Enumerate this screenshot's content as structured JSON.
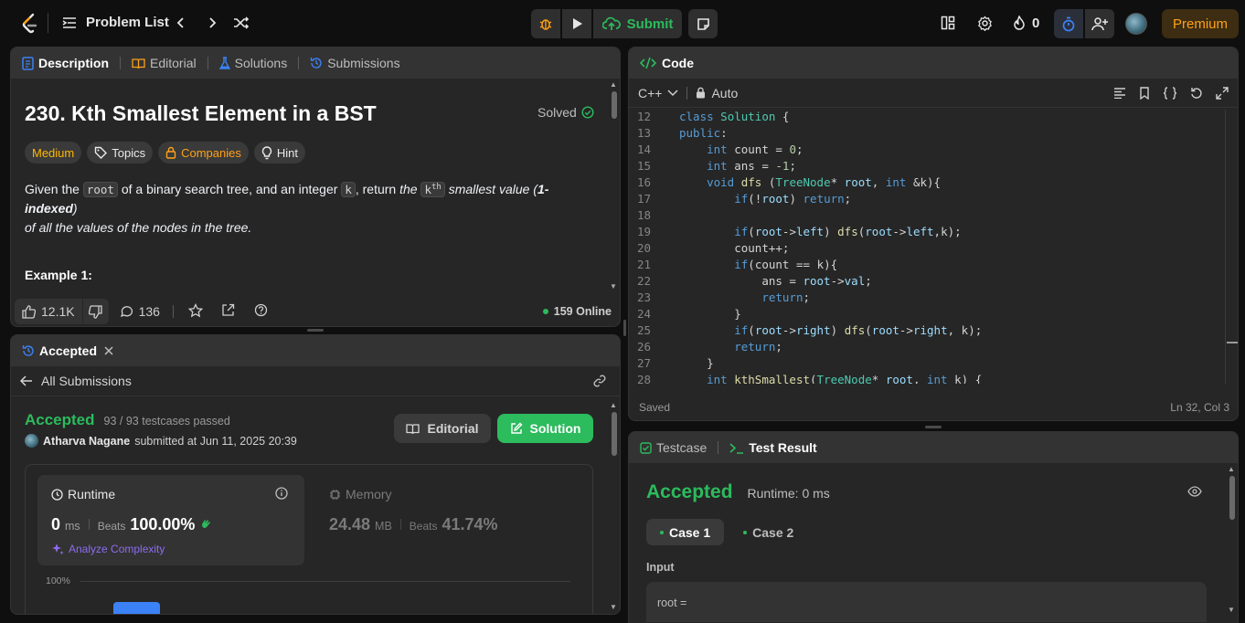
{
  "topbar": {
    "problem_list": "Problem List",
    "submit": "Submit",
    "streak_count": "0",
    "premium": "Premium"
  },
  "description": {
    "tabs": [
      "Description",
      "Editorial",
      "Solutions",
      "Submissions"
    ],
    "title": "230. Kth Smallest Element in a BST",
    "status": "Solved",
    "difficulty": "Medium",
    "chips": [
      "Topics",
      "Companies",
      "Hint"
    ],
    "text_1": "Given the",
    "code_root": "root",
    "text_2": "of a binary search tree, and an integer",
    "code_k": "k",
    "text_3": ", return",
    "text_the": "the",
    "code_kth_base": "k",
    "code_kth_sup": "th",
    "text_4": "smallest value (",
    "text_bold": "1-indexed",
    "text_5": ")",
    "text_6": "of all the values of the nodes in the tree.",
    "example_heading": "Example 1:",
    "likes": "12.1K",
    "comments": "136",
    "online": "159 Online"
  },
  "accepted_panel": {
    "tab": "Accepted",
    "back": "All Submissions",
    "status": "Accepted",
    "testcases": "93 / 93 testcases passed",
    "user": "Atharva Nagane",
    "submitted": "submitted at Jun 11, 2025 20:39",
    "editorial_btn": "Editorial",
    "solution_btn": "Solution",
    "runtime_label": "Runtime",
    "runtime_value": "0",
    "runtime_unit": "ms",
    "beats_label": "Beats",
    "runtime_beats": "100.00%",
    "analyze": "Analyze Complexity",
    "memory_label": "Memory",
    "memory_value": "24.48",
    "memory_unit": "MB",
    "memory_beats": "41.74%",
    "chart_label": "100%"
  },
  "code_panel": {
    "title": "Code",
    "language": "C++",
    "mode": "Auto",
    "saved": "Saved",
    "cursor": "Ln 32, Col 3",
    "lines": [
      {
        "n": "12",
        "code": "class Solution {"
      },
      {
        "n": "13",
        "code": "public:"
      },
      {
        "n": "14",
        "code": "    int count = 0;"
      },
      {
        "n": "15",
        "code": "    int ans = -1;"
      },
      {
        "n": "16",
        "code": "    void dfs (TreeNode* root, int &k){"
      },
      {
        "n": "17",
        "code": "        if(!root) return;"
      },
      {
        "n": "18",
        "code": ""
      },
      {
        "n": "19",
        "code": "        if(root->left) dfs(root->left,k);"
      },
      {
        "n": "20",
        "code": "        count++;"
      },
      {
        "n": "21",
        "code": "        if(count == k){"
      },
      {
        "n": "22",
        "code": "            ans = root->val;"
      },
      {
        "n": "23",
        "code": "            return;"
      },
      {
        "n": "24",
        "code": "        }"
      },
      {
        "n": "25",
        "code": "        if(root->right) dfs(root->right, k);"
      },
      {
        "n": "26",
        "code": "        return;"
      },
      {
        "n": "27",
        "code": "    }"
      },
      {
        "n": "28",
        "code": "    int kthSmallest(TreeNode* root, int k) {"
      }
    ]
  },
  "result_panel": {
    "tabs": [
      "Testcase",
      "Test Result"
    ],
    "status": "Accepted",
    "runtime": "Runtime: 0 ms",
    "cases": [
      "Case 1",
      "Case 2"
    ],
    "input_label": "Input",
    "input_first": "root ="
  },
  "colors": {
    "accent_green": "#2cbb5d",
    "medium": "#ffb800",
    "premium": "#ffa116",
    "blue": "#3b82f6"
  }
}
